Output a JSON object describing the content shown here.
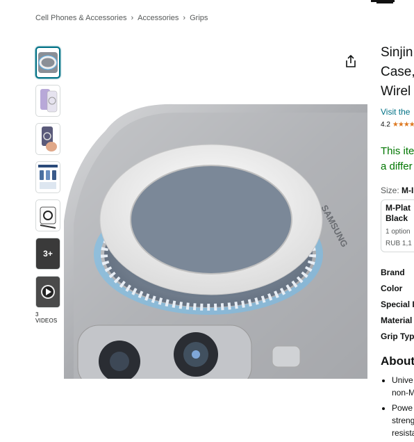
{
  "breadcrumb": [
    "Cell Phones & Accessories",
    "Accessories",
    "Grips"
  ],
  "breadcrumb_sep": "›",
  "thumbnails": {
    "more_label": "3+",
    "videos_label": "3 VIDEOS"
  },
  "product": {
    "title_lines": [
      "Sinjin",
      "Case,",
      "Wirel"
    ],
    "store_link": "Visit the",
    "rating": "4.2",
    "stars": "★★★★",
    "notice_lines": [
      "This ite",
      "a differ"
    ],
    "size_label": "Size:",
    "size_value": "M-I",
    "size_card": {
      "name_lines": [
        "M-Plat",
        "Black"
      ],
      "options": "1 option",
      "price": "RUB 1,1"
    },
    "specs": [
      "Brand",
      "Color",
      "Special I",
      "Material",
      "Grip Typ"
    ],
    "about_heading": "About",
    "bullets": [
      [
        "Unive",
        "non-M"
      ],
      [
        "Powe",
        "streng",
        "resista"
      ]
    ]
  },
  "colors": {
    "link": "#007185",
    "notice": "#007600",
    "star": "#de7921"
  }
}
